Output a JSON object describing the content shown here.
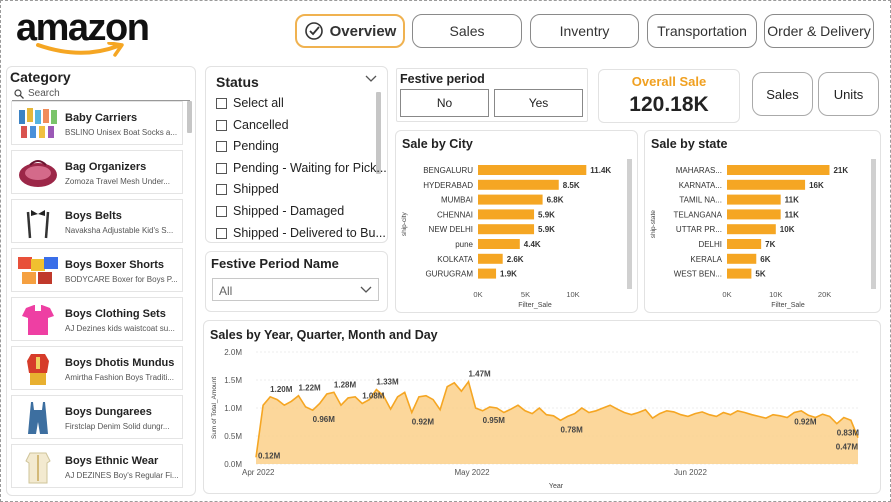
{
  "brand": {
    "logo_text": "amazon"
  },
  "nav": {
    "tabs": [
      {
        "label": "Overview",
        "active": true
      },
      {
        "label": "Sales",
        "active": false
      },
      {
        "label": "Inventry",
        "active": false
      },
      {
        "label": "Transportation",
        "active": false
      },
      {
        "label": "Order & Delivery",
        "active": false
      }
    ]
  },
  "category": {
    "title": "Category",
    "search_placeholder": "Search",
    "items": [
      {
        "name": "Baby Carriers",
        "desc": "BSLINO Unisex Boat Socks a..."
      },
      {
        "name": "Bag Organizers",
        "desc": "Zomoza Travel Mesh Under..."
      },
      {
        "name": "Boys Belts",
        "desc": "Navaksha Adjustable Kid's S..."
      },
      {
        "name": "Boys Boxer Shorts",
        "desc": "BODYCARE Boxer for Boys P..."
      },
      {
        "name": "Boys Clothing Sets",
        "desc": "AJ Dezines kids waistcoat su..."
      },
      {
        "name": "Boys Dhotis Mundus",
        "desc": "Amirtha Fashion Boys Traditi..."
      },
      {
        "name": "Boys Dungarees",
        "desc": "Firstclap Denim Solid dungr..."
      },
      {
        "name": "Boys Ethnic Wear",
        "desc": "AJ DEZINES Boy's Regular Fi..."
      }
    ]
  },
  "status": {
    "title": "Status",
    "options": [
      "Select all",
      "Cancelled",
      "Pending",
      "Pending - Waiting for Pick...",
      "Shipped",
      "Shipped - Damaged",
      "Shipped - Delivered to Bu..."
    ]
  },
  "festive": {
    "title": "Festive period",
    "options": [
      "No",
      "Yes"
    ],
    "name_title": "Festive Period Name",
    "name_selected": "All"
  },
  "kpi": {
    "label": "Overall Sale",
    "value": "120.18K"
  },
  "metric_toggle": {
    "options": [
      "Sales",
      "Units"
    ]
  },
  "colors": {
    "accent": "#f5a623",
    "area_fill": "#fbd08a",
    "kpi_label": "#f0a020"
  },
  "chart_data": [
    {
      "type": "bar",
      "orientation": "horizontal",
      "title": "Sale by City",
      "xlabel": "Filter_Sale",
      "ylabel": "ship-city",
      "categories": [
        "BENGALURU",
        "HYDERABAD",
        "MUMBAI",
        "CHENNAI",
        "NEW DELHI",
        "pune",
        "KOLKATA",
        "GURUGRAM"
      ],
      "values": [
        11.4,
        8.5,
        6.8,
        5.9,
        5.9,
        4.4,
        2.6,
        1.9
      ],
      "value_labels": [
        "11.4K",
        "8.5K",
        "6.8K",
        "5.9K",
        "5.9K",
        "4.4K",
        "2.6K",
        "1.9K"
      ],
      "xticks": [
        "0K",
        "5K",
        "10K"
      ],
      "xlim": [
        0,
        12
      ],
      "unit": "K"
    },
    {
      "type": "bar",
      "orientation": "horizontal",
      "title": "Sale by state",
      "xlabel": "Filter_Sale",
      "ylabel": "ship-state",
      "categories": [
        "MAHARAS...",
        "KARNATA...",
        "TAMIL NA...",
        "TELANGANA",
        "UTTAR PR...",
        "DELHI",
        "KERALA",
        "WEST BEN..."
      ],
      "values": [
        21,
        16,
        11,
        11,
        10,
        7,
        6,
        5
      ],
      "value_labels": [
        "21K",
        "16K",
        "11K",
        "11K",
        "10K",
        "7K",
        "6K",
        "5K"
      ],
      "xticks": [
        "0K",
        "10K",
        "20K"
      ],
      "xlim": [
        0,
        25
      ],
      "unit": "K"
    },
    {
      "type": "area",
      "title": "Sales by Year, Quarter, Month and Day",
      "xlabel": "Year",
      "ylabel": "Sum of Total_Amount",
      "ylim": [
        0,
        2.0
      ],
      "yticks": [
        "0.0M",
        "0.5M",
        "1.0M",
        "1.5M",
        "2.0M"
      ],
      "xticks": [
        {
          "label": "Apr 2022",
          "day": 0
        },
        {
          "label": "May 2022",
          "day": 30
        },
        {
          "label": "Jun 2022",
          "day": 61
        }
      ],
      "series": [
        {
          "values": [
            0.12,
            1.05,
            1.2,
            1.15,
            1.05,
            1.12,
            1.22,
            1.02,
            0.96,
            1.08,
            1.25,
            1.28,
            1.05,
            1.18,
            1.2,
            1.08,
            1.15,
            1.33,
            1.22,
            0.98,
            1.2,
            1.28,
            0.92,
            1.2,
            1.22,
            1.15,
            0.97,
            1.38,
            1.45,
            1.3,
            1.47,
            1.0,
            0.95,
            1.02,
            1.0,
            0.92,
            0.98,
            1.05,
            0.95,
            0.9,
            1.0,
            0.88,
            0.86,
            0.78,
            0.85,
            0.9,
            1.0,
            0.92,
            0.95,
            1.0,
            1.05,
            0.98,
            0.92,
            0.88,
            0.92,
            0.97,
            0.82,
            0.9,
            0.95,
            0.93,
            0.88,
            0.85,
            0.9,
            0.93,
            0.88,
            0.85,
            0.92,
            0.88,
            0.95,
            0.92,
            0.88,
            0.85,
            0.82,
            0.88,
            0.86,
            0.83,
            0.92,
            0.95,
            0.87,
            0.83,
            0.89,
            0.85,
            0.72,
            0.83,
            0.78,
            0.47
          ]
        }
      ],
      "annotations": [
        {
          "day": 0,
          "label": "0.12M"
        },
        {
          "day": 2,
          "label": "1.20M"
        },
        {
          "day": 6,
          "label": "1.22M"
        },
        {
          "day": 8,
          "label": "0.96M"
        },
        {
          "day": 11,
          "label": "1.28M"
        },
        {
          "day": 15,
          "label": "1.08M"
        },
        {
          "day": 17,
          "label": "1.33M"
        },
        {
          "day": 22,
          "label": "0.92M"
        },
        {
          "day": 30,
          "label": "1.47M"
        },
        {
          "day": 32,
          "label": "0.95M"
        },
        {
          "day": 43,
          "label": "0.78M"
        },
        {
          "day": 76,
          "label": "0.92M"
        },
        {
          "day": 82,
          "label": "0.83M"
        },
        {
          "day": 85,
          "label": "0.47M"
        }
      ]
    }
  ]
}
